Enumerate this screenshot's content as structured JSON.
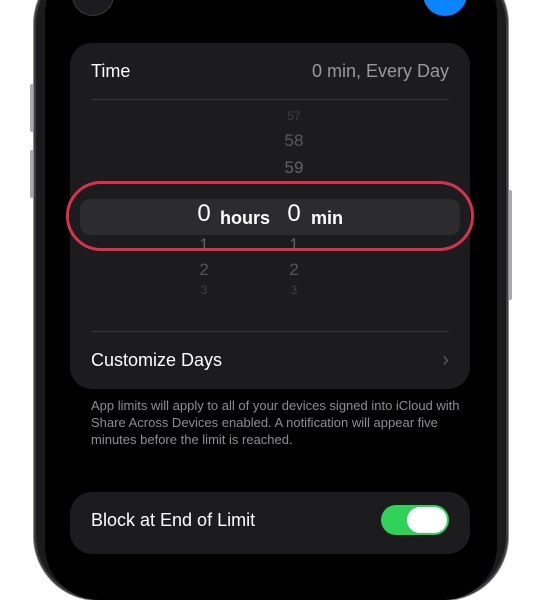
{
  "colors": {
    "accent": "#0a84ff",
    "toggle_on": "#30d158",
    "highlight": "#d9304b"
  },
  "time_card": {
    "label": "Time",
    "value": "0 min, Every Day",
    "picker": {
      "hours": {
        "above": [
          "",
          "",
          ""
        ],
        "selected": "0",
        "below": [
          "1",
          "2",
          "3"
        ],
        "unit": "hours"
      },
      "minutes": {
        "above": [
          "57",
          "58",
          "59"
        ],
        "selected": "0",
        "below": [
          "1",
          "2",
          "3"
        ],
        "unit": "min"
      }
    },
    "customize_days": {
      "label": "Customize Days",
      "chevron_icon": "chevron-right-icon"
    }
  },
  "footnote": "App limits will apply to all of your devices signed into iCloud with Share Across Devices enabled. A notification will appear five minutes before the limit is reached.",
  "block_card": {
    "label": "Block at End of Limit",
    "toggle": "on"
  }
}
